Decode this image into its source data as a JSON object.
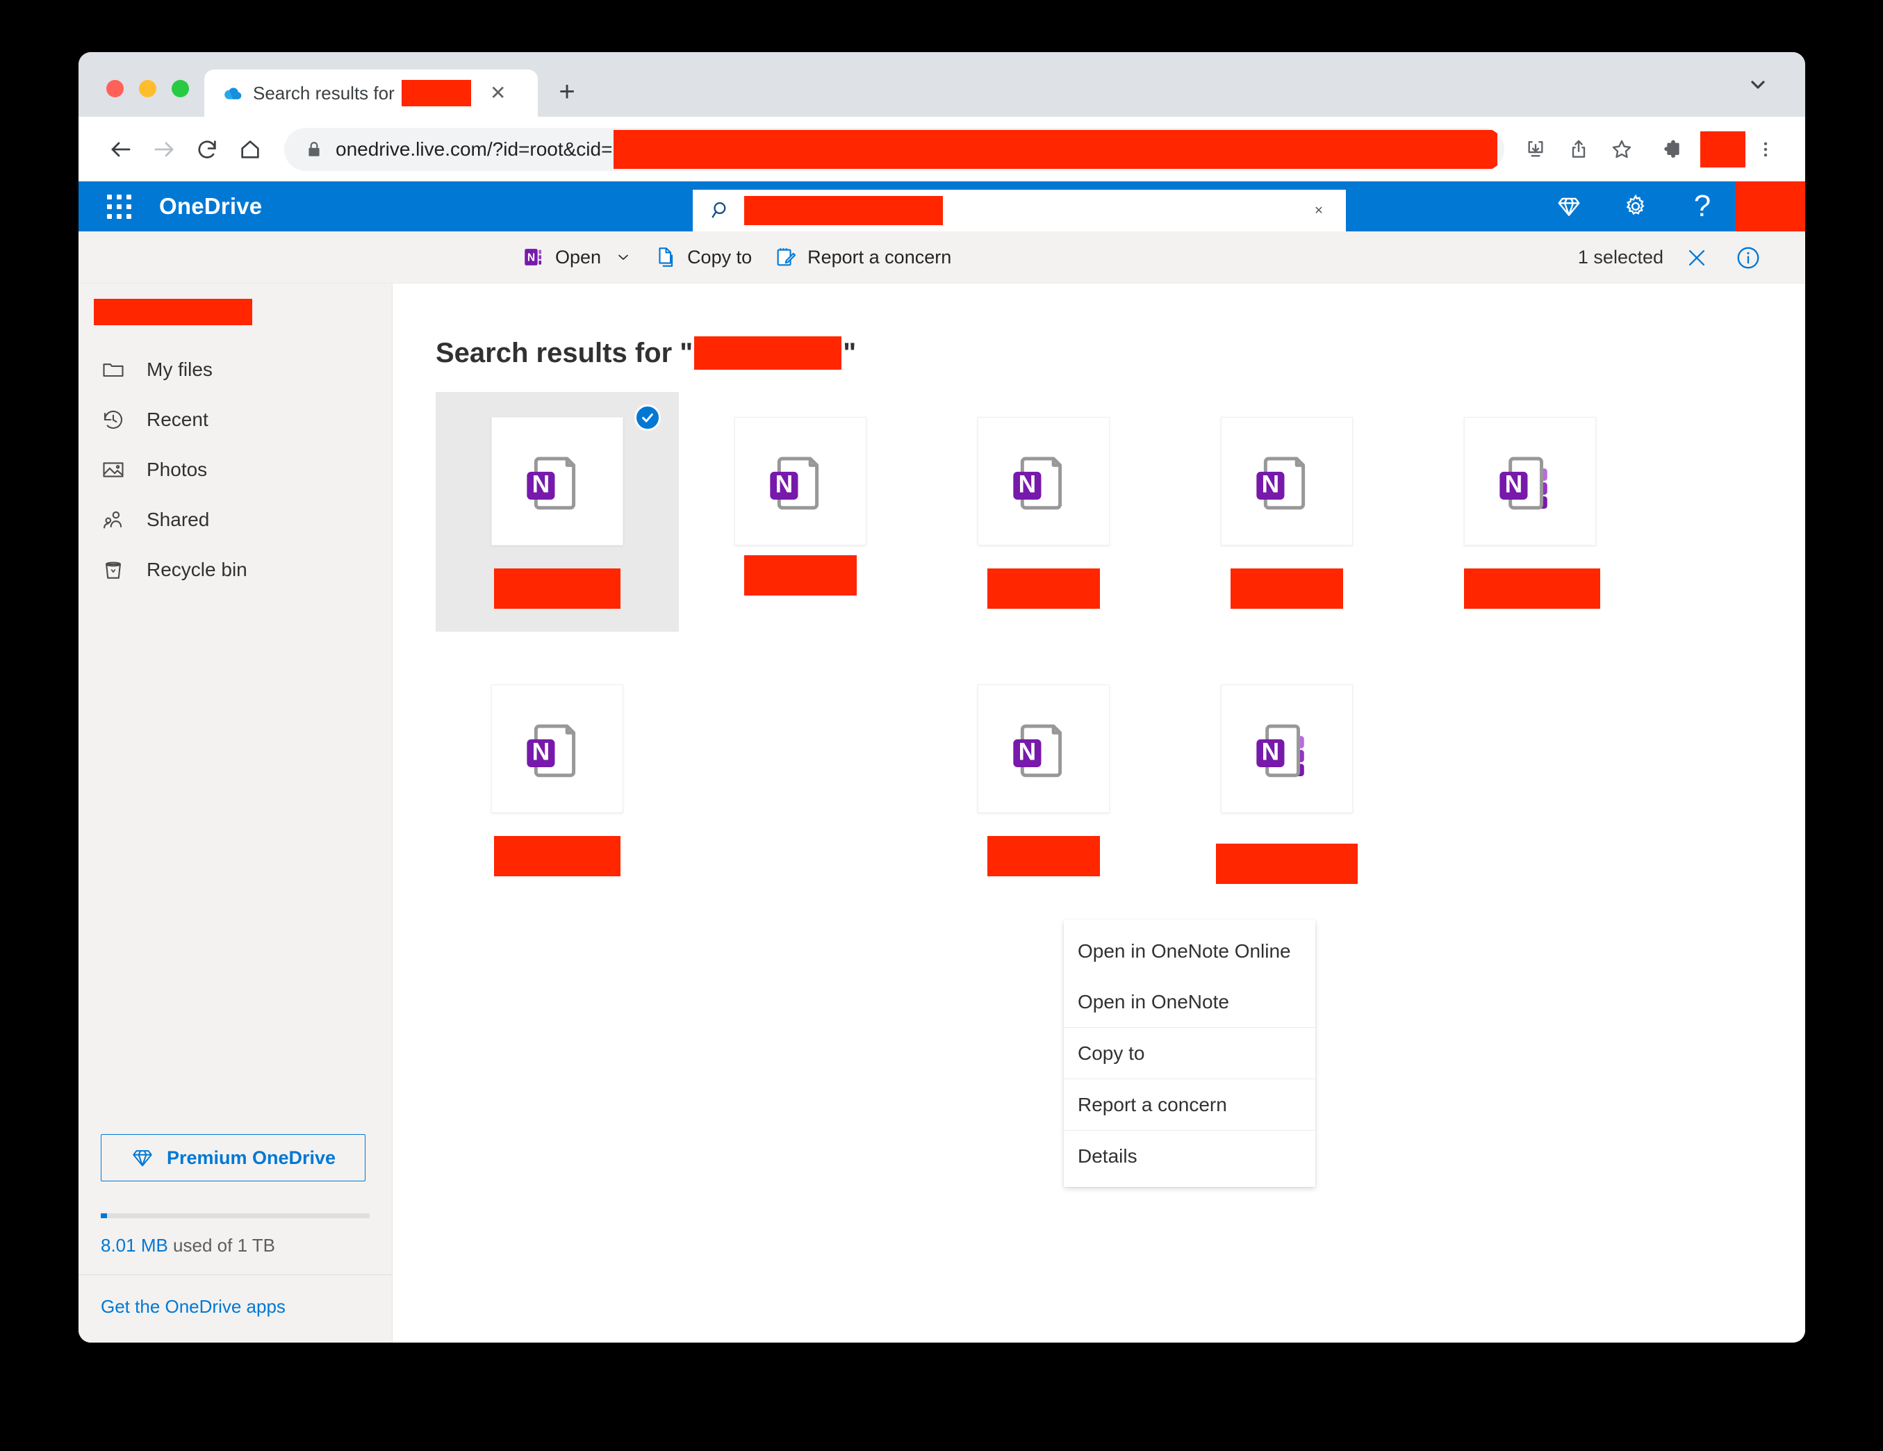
{
  "browser": {
    "tab": {
      "title": "Search results for",
      "favicon": "onedrive-cloud-icon",
      "close_label": "✕",
      "redacted": true
    },
    "new_tab_label": "+",
    "tab_list_icon": "chevron-down-icon",
    "omnibox": {
      "url": "onedrive.live.com/?id=root&cid=",
      "lock_icon": "lock-icon",
      "redacted_suffix": true
    },
    "nav": {
      "back": "back-arrow-icon",
      "forward": "forward-arrow-icon",
      "reload": "reload-icon",
      "home": "home-icon"
    },
    "actions": {
      "install": "install-app-icon",
      "share": "share-icon",
      "bookmark": "bookmark-star-icon",
      "extensions": "extensions-puzzle-icon",
      "profile": "profile-avatar-redacted",
      "menu": "three-dot-menu-icon"
    }
  },
  "suite_bar": {
    "waffle": "app-launcher-waffle-icon",
    "brand": "OneDrive",
    "search": {
      "icon": "search-icon",
      "value_redacted": true,
      "clear_label": "✕"
    },
    "right_icons": [
      {
        "name": "premium-diamond-icon",
        "glyph": "diamond"
      },
      {
        "name": "settings-gear-icon",
        "glyph": "gear"
      },
      {
        "name": "help-question-icon",
        "glyph": "?"
      }
    ],
    "avatar_redacted": true
  },
  "command_bar": {
    "items": [
      {
        "label": "Open",
        "icon": "onenote-icon",
        "has_chevron": true
      },
      {
        "label": "Copy to",
        "icon": "copy-document-icon",
        "has_chevron": false
      },
      {
        "label": "Report a concern",
        "icon": "report-pencil-icon",
        "has_chevron": false
      }
    ],
    "chevron": "⌄",
    "selection_status": "1 selected",
    "clear_selection_icon": "close-x-icon",
    "details_icon": "info-circle-icon"
  },
  "sidebar": {
    "account_redacted": true,
    "items": [
      {
        "label": "My files",
        "icon": "folder-icon"
      },
      {
        "label": "Recent",
        "icon": "clock-history-icon"
      },
      {
        "label": "Photos",
        "icon": "photo-icon"
      },
      {
        "label": "Shared",
        "icon": "people-icon"
      },
      {
        "label": "Recycle bin",
        "icon": "recycle-bin-icon"
      }
    ],
    "premium_button": {
      "label": "Premium OneDrive",
      "icon": "diamond-icon"
    },
    "storage": {
      "used": "8.01 MB",
      "suffix": " used of 1 TB",
      "percent": 0.8
    },
    "get_apps_link": "Get the OneDrive apps"
  },
  "main": {
    "title_prefix": "Search results for \"",
    "title_suffix": "\"",
    "query_redacted": true,
    "tiles": [
      {
        "row": 1,
        "col": 1,
        "icon": "onenote-notebook-icon",
        "variant": "plain",
        "selected": true,
        "label_width": 182,
        "visible": true
      },
      {
        "row": 1,
        "col": 2,
        "icon": "onenote-notebook-icon",
        "variant": "plain",
        "selected": false,
        "label_width": 162,
        "visible": true
      },
      {
        "row": 1,
        "col": 3,
        "icon": "onenote-notebook-icon",
        "variant": "plain",
        "selected": false,
        "label_width": 162,
        "visible": true
      },
      {
        "row": 1,
        "col": 4,
        "icon": "onenote-notebook-icon",
        "variant": "plain",
        "selected": false,
        "label_width": 162,
        "visible": true
      },
      {
        "row": 1,
        "col": 5,
        "icon": "onenote-notebook-icon",
        "variant": "tabs",
        "selected": false,
        "label_width": 196,
        "visible": true
      },
      {
        "row": 2,
        "col": 1,
        "icon": "onenote-notebook-icon",
        "variant": "plain",
        "selected": false,
        "label_width": 182,
        "visible": true
      },
      {
        "row": 2,
        "col": 2,
        "icon": "onenote-notebook-icon",
        "variant": "plain",
        "selected": false,
        "label_width": 162,
        "visible": false
      },
      {
        "row": 2,
        "col": 3,
        "icon": "onenote-notebook-icon",
        "variant": "plain",
        "selected": false,
        "label_width": 162,
        "visible": true
      },
      {
        "row": 2,
        "col": 4,
        "icon": "onenote-notebook-icon",
        "variant": "tabs",
        "selected": false,
        "label_width": 204,
        "visible": true
      }
    ],
    "selected_check_icon": "check-circle-icon"
  },
  "context_menu": {
    "items": [
      {
        "label": "Open in OneNote Online",
        "sep_after": false
      },
      {
        "label": "Open in OneNote",
        "sep_after": true
      },
      {
        "label": "Copy to",
        "sep_after": true
      },
      {
        "label": "Report a concern",
        "sep_after": true
      },
      {
        "label": "Details",
        "sep_after": false
      }
    ]
  },
  "colors": {
    "suite_blue": "#0078d4",
    "chrome_tabstrip": "#dee1e6",
    "command_bar_bg": "#f3f2f1",
    "sidebar_bg": "#f3f2f1",
    "redaction_red": "#ff2600",
    "onenote_purple": "#7719aa",
    "selection_gray": "#e9e9e9"
  }
}
